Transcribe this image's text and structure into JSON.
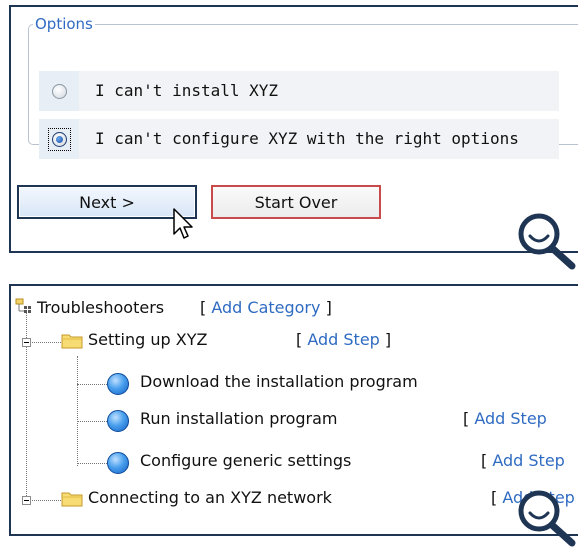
{
  "options": {
    "legend": "Options",
    "items": [
      {
        "label": "I can't install XYZ",
        "checked": false
      },
      {
        "label": "I can't configure XYZ with the right options",
        "checked": true
      }
    ],
    "next_label": "Next >",
    "start_over_label": "Start Over"
  },
  "tree": {
    "root": {
      "label": "Troubleshooters",
      "action": "Add Category"
    },
    "categories": [
      {
        "label": "Setting up XYZ",
        "action": "Add Step",
        "steps": [
          {
            "label": "Download the installation program",
            "action": ""
          },
          {
            "label": "Run installation program",
            "action": "Add Step"
          },
          {
            "label": "Configure generic settings",
            "action": "Add Step"
          }
        ]
      },
      {
        "label": "Connecting to an XYZ network",
        "action": "Add Step"
      }
    ]
  },
  "colors": {
    "frame": "#1f3554",
    "link": "#2f6bc2",
    "start_over_border": "#c94a4a",
    "magnifier": "#1f3554"
  },
  "icons": [
    "radio-unchecked-icon",
    "radio-checked-icon",
    "mouse-cursor-icon",
    "magnifier-icon",
    "tree-root-icon",
    "folder-icon",
    "expander-minus-icon",
    "step-bullet-icon"
  ]
}
